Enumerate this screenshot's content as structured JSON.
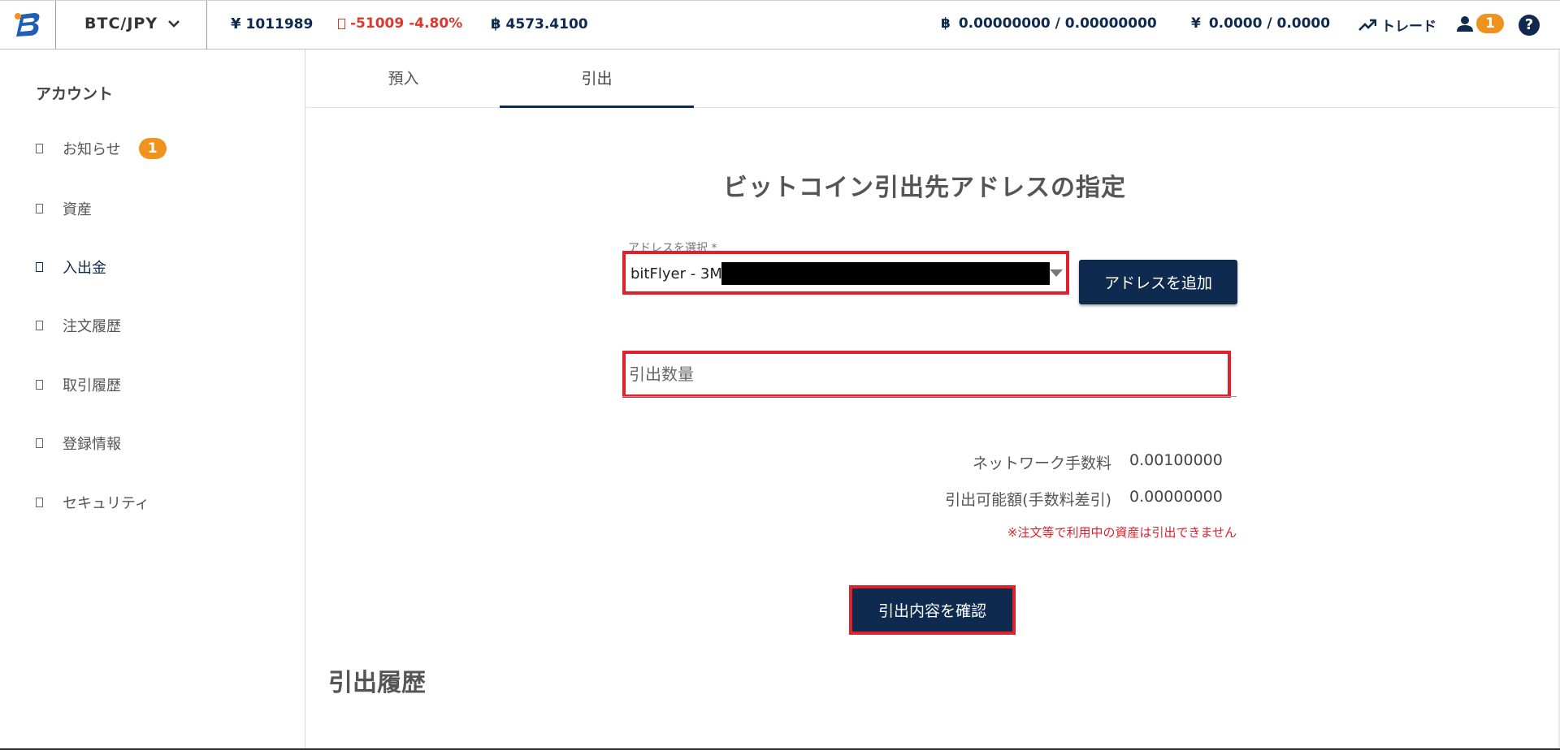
{
  "header": {
    "pair_label": "BTC/JPY",
    "price": {
      "symbol": "¥",
      "value": "1011989"
    },
    "change": {
      "value": "-51009",
      "percent": "-4.80%"
    },
    "btc_rate": {
      "symbol": "฿",
      "value": "4573.4100"
    },
    "btc_balance": {
      "symbol": "฿",
      "value": "0.00000000 / 0.00000000"
    },
    "jpy_balance": {
      "symbol": "¥",
      "value": "0.0000 / 0.0000"
    },
    "trade_label": "トレード",
    "user_badge": "1",
    "help_label": "?",
    "colors": {
      "navy": "#0e2a4e",
      "negative": "#d83a2e",
      "badge": "#f0921e"
    }
  },
  "sidebar": {
    "title": "アカウント",
    "items": [
      {
        "label": "お知らせ",
        "badge": "1"
      },
      {
        "label": "資産"
      },
      {
        "label": "入出金",
        "active": true
      },
      {
        "label": "注文履歴"
      },
      {
        "label": "取引履歴"
      },
      {
        "label": "登録情報"
      },
      {
        "label": "セキュリティ"
      }
    ]
  },
  "tabs": [
    {
      "label": "預入"
    },
    {
      "label": "引出",
      "active": true
    }
  ],
  "form": {
    "title": "ビットコイン引出先アドレスの指定",
    "select_label": "アドレスを選択 *",
    "select_value": "bitFlyer - 3M",
    "add_address_label": "アドレスを追加",
    "amount_placeholder": "引出数量",
    "network_fee_label": "ネットワーク手数料",
    "network_fee_value": "0.00100000",
    "available_label": "引出可能額(手数料差引)",
    "available_value": "0.00000000",
    "notice": "※注文等で利用中の資産は引出できません",
    "confirm_label": "引出内容を確認",
    "highlight_color": "#e0202a"
  },
  "history": {
    "title": "引出履歴"
  }
}
